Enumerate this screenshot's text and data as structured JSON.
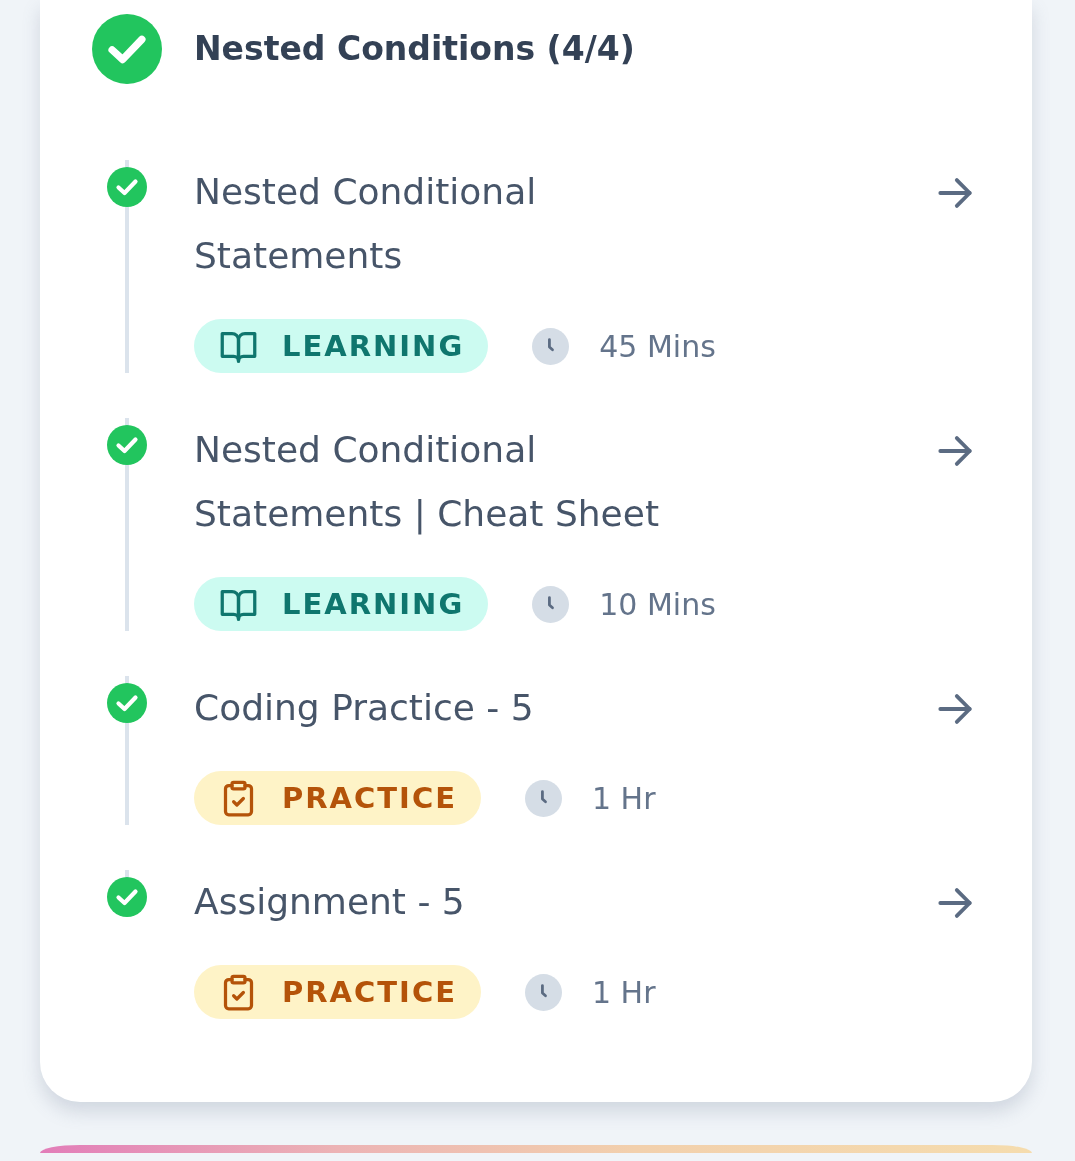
{
  "section": {
    "title": "Nested Conditions (4/4)",
    "completed": true
  },
  "items": [
    {
      "title": "Nested Conditional Statements",
      "completed": true,
      "kind": "learning",
      "tag": "LEARNING",
      "duration": "45 Mins"
    },
    {
      "title": "Nested Conditional Statements | Cheat Sheet",
      "completed": true,
      "kind": "learning",
      "tag": "LEARNING",
      "duration": "10 Mins"
    },
    {
      "title": "Coding Practice - 5",
      "completed": true,
      "kind": "practice",
      "tag": "PRACTICE",
      "duration": "1 Hr"
    },
    {
      "title": "Assignment - 5",
      "completed": true,
      "kind": "practice",
      "tag": "PRACTICE",
      "duration": "1 Hr"
    }
  ]
}
